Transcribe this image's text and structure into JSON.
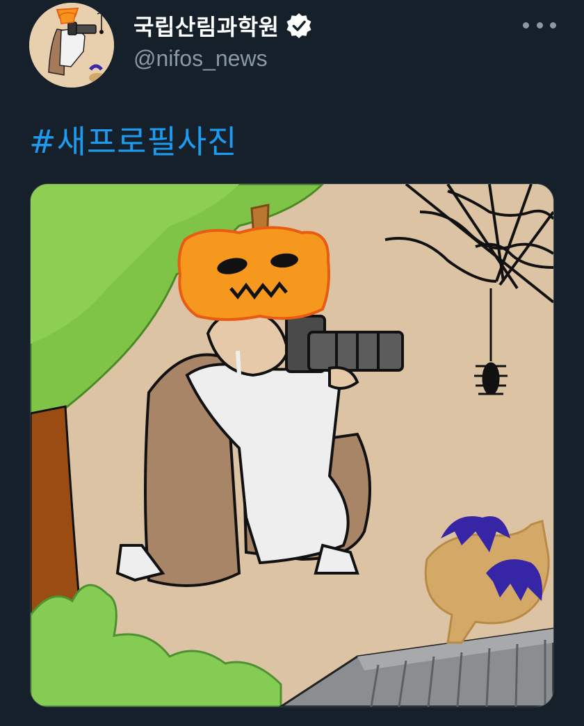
{
  "account": {
    "display_name": "국립산림과학원",
    "handle": "@nifos_news",
    "verified": true
  },
  "icons": {
    "verified": "verified-badge-icon",
    "more": "more-options-icon"
  },
  "tweet": {
    "text": "#새프로필사진"
  },
  "colors": {
    "background": "#15202b",
    "link": "#1d9bf0",
    "secondary_text": "#8b98a5"
  }
}
